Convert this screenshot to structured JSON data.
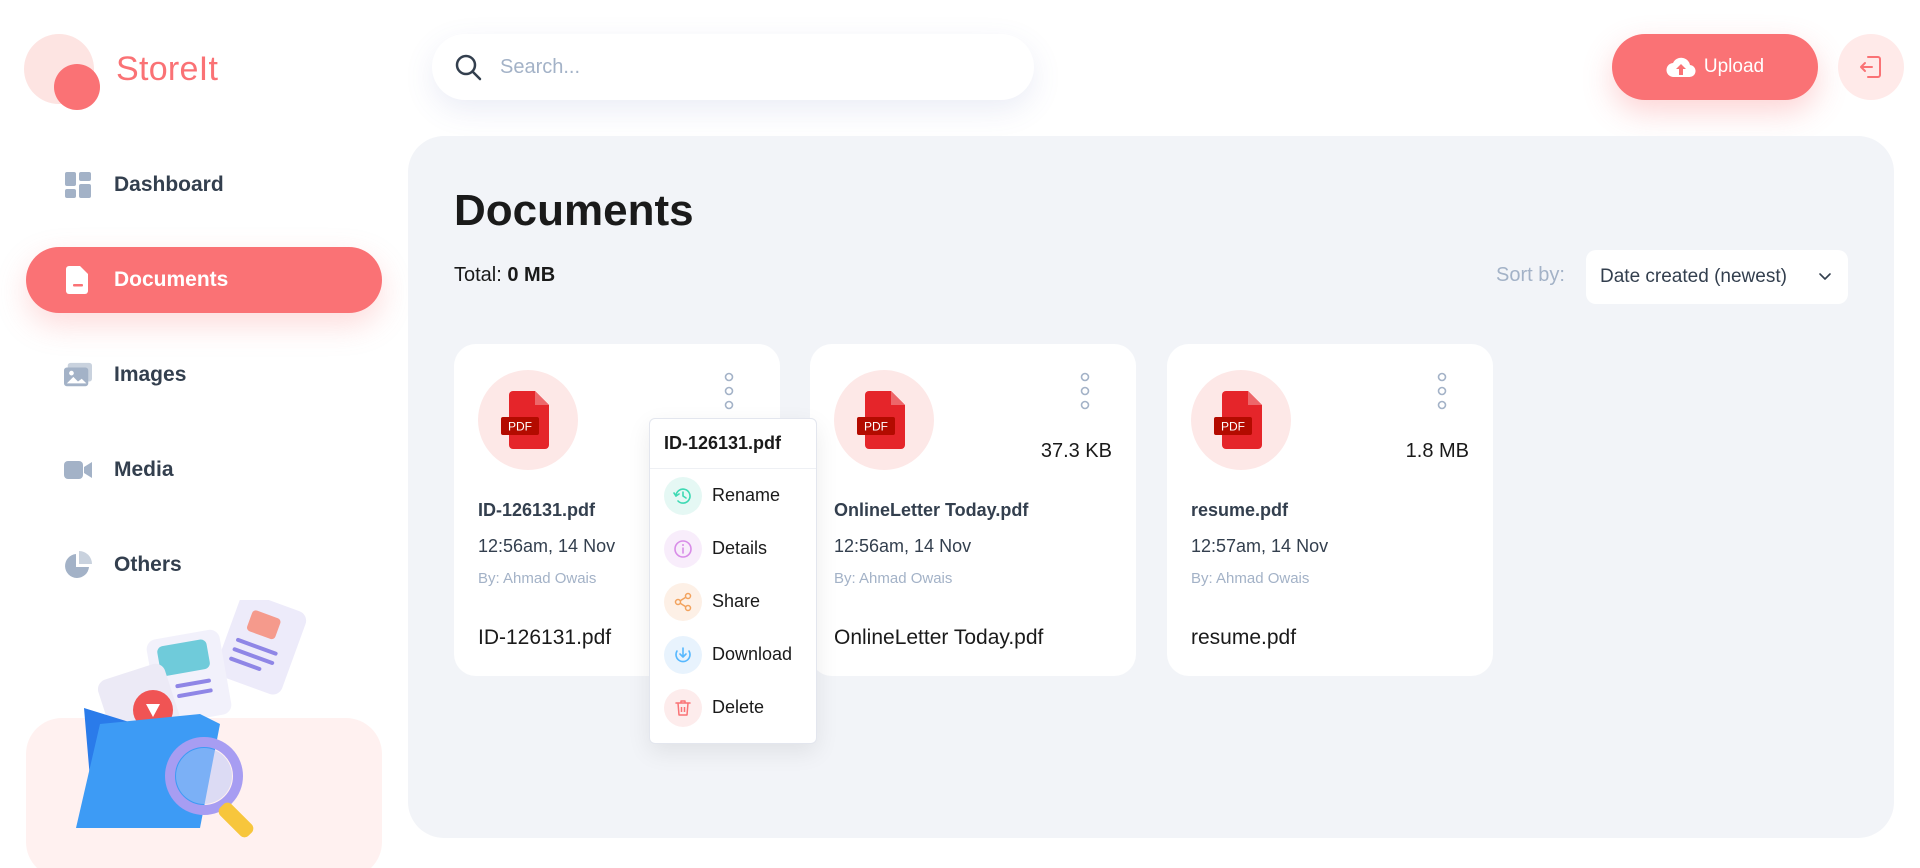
{
  "app": {
    "name": "StoreIt"
  },
  "sidebar": {
    "items": [
      {
        "label": "Dashboard",
        "icon": "dashboard-icon",
        "active": false
      },
      {
        "label": "Documents",
        "icon": "documents-icon",
        "active": true
      },
      {
        "label": "Images",
        "icon": "images-icon",
        "active": false
      },
      {
        "label": "Media",
        "icon": "media-icon",
        "active": false
      },
      {
        "label": "Others",
        "icon": "others-icon",
        "active": false
      }
    ]
  },
  "header": {
    "search_placeholder": "Search...",
    "upload_label": "Upload"
  },
  "main": {
    "title": "Documents",
    "total_label": "Total:",
    "total_value": "0 MB",
    "sort_label": "Sort by:",
    "sort_value": "Date created (newest)"
  },
  "files": [
    {
      "name": "ID-126131.pdf",
      "size": "",
      "date": "12:56am, 14 Nov",
      "owner": "By: Ahmad Owais"
    },
    {
      "name": "OnlineLetter Today.pdf",
      "size": "37.3 KB",
      "date": "12:56am, 14 Nov",
      "owner": "By: Ahmad Owais"
    },
    {
      "name": "resume.pdf",
      "size": "1.8 MB",
      "date": "12:57am, 14 Nov",
      "owner": "By: Ahmad Owais"
    }
  ],
  "context_menu": {
    "title": "ID-126131.pdf",
    "items": [
      {
        "label": "Rename",
        "icon": "rename-icon"
      },
      {
        "label": "Details",
        "icon": "details-icon"
      },
      {
        "label": "Share",
        "icon": "share-icon"
      },
      {
        "label": "Download",
        "icon": "download-icon"
      },
      {
        "label": "Delete",
        "icon": "delete-icon"
      }
    ]
  },
  "file_badge": "PDF",
  "colors": {
    "brand": "#FA7275",
    "text": "#333F4E",
    "muted": "#A3B2C7",
    "panel": "#F2F4F8"
  }
}
